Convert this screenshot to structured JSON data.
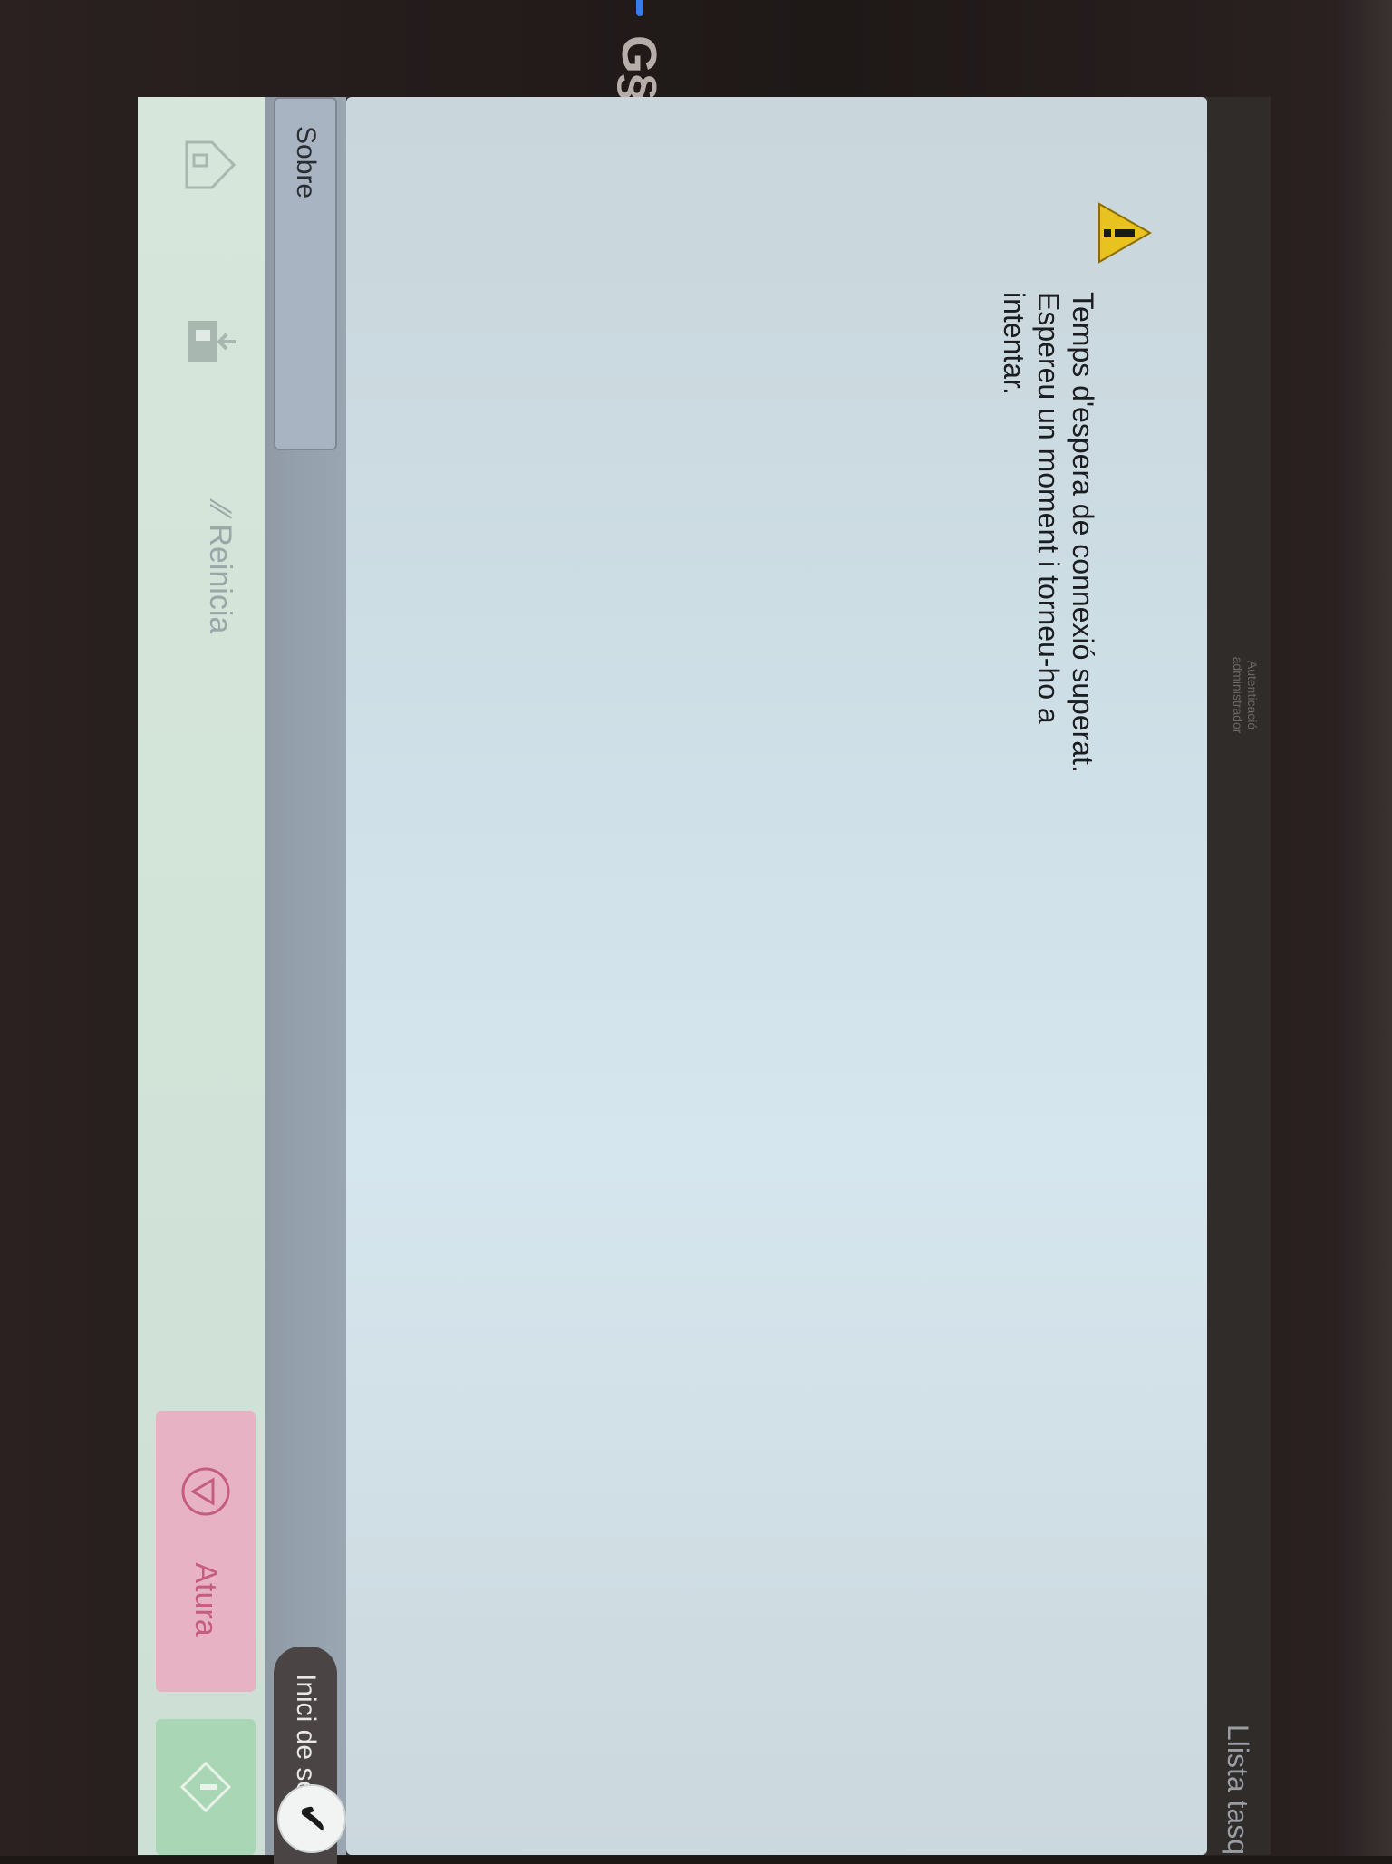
{
  "header": {
    "authentication_label": "Autenticació",
    "administrator_label": "administrador",
    "task_list_label": "Llista tasq"
  },
  "dialog": {
    "message_line1": "Temps d'espera de connexió superat.",
    "message_line2": "Espereu un moment i torneu-ho a",
    "message_line3": "intentar."
  },
  "actions": {
    "about_label": "Sobre",
    "login_label": "Inici de sessió"
  },
  "bottom_bar": {
    "reset_label": "Reinicia",
    "stop_label": "Atura"
  },
  "colors": {
    "stop_button": "#e7b3c4",
    "start_button": "#a9d6b4",
    "panel": "#cfe0e8",
    "led": "#3a7cf0"
  },
  "icons": [
    "warning-icon",
    "home-icon",
    "job-status-icon",
    "reset-icon",
    "stop-icon",
    "start-icon",
    "check-icon",
    "brand-logo-icon"
  ]
}
